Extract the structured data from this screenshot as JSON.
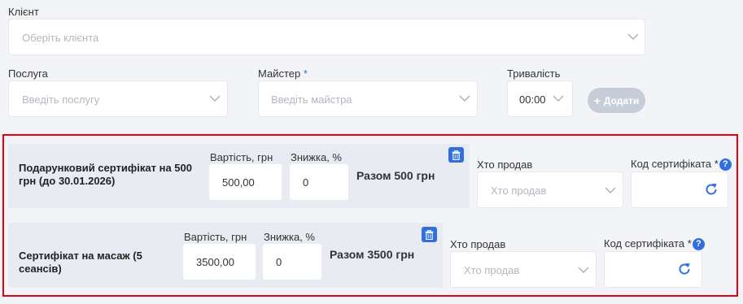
{
  "client": {
    "label": "Клієнт",
    "placeholder": "Оберіть клієнта"
  },
  "service": {
    "label": "Послуга",
    "placeholder": "Введіть послугу"
  },
  "master": {
    "label": "Майстер",
    "required_mark": "*",
    "placeholder": "Введіть майстра"
  },
  "duration": {
    "label": "Тривалість",
    "value": "00:00"
  },
  "add_button": {
    "icon": "+",
    "label": "Додати"
  },
  "items": [
    {
      "title": "Подарунковий сертифікат на 500 грн (до 30.01.2026)",
      "price_label": "Вартість, грн",
      "price_value": "500,00",
      "discount_label": "Знижка, %",
      "discount_value": "0",
      "total": "Разом 500 грн",
      "seller_label": "Хто продав",
      "seller_placeholder": "Хто продав",
      "code_label": "Код сертифіката *",
      "help": "?"
    },
    {
      "title": "Сертифікат на масаж (5 сеансів)",
      "price_label": "Вартість, грн",
      "price_value": "3500,00",
      "discount_label": "Знижка, %",
      "discount_value": "0",
      "total": "Разом 3500 грн",
      "seller_label": "Хто продав",
      "seller_placeholder": "Хто продав",
      "code_label": "Код сертифіката *",
      "help": "?"
    }
  ],
  "colors": {
    "accent": "#2f6fe0",
    "highlight_border": "#e3000f",
    "card_bg": "#e8ebf1",
    "page_bg": "#f3f4f7"
  }
}
